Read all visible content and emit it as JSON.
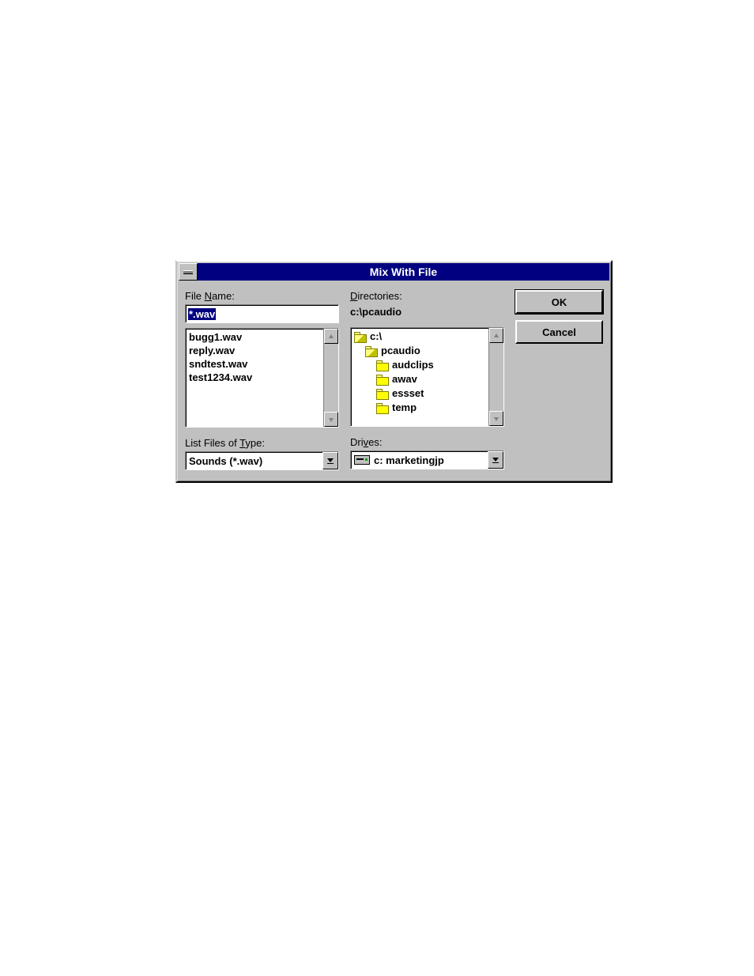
{
  "title": "Mix With File",
  "labels": {
    "file_name_pre": "File ",
    "file_name_ul": "N",
    "file_name_post": "ame:",
    "directories_ul": "D",
    "directories_post": "irectories:",
    "list_type_pre": "List Files of ",
    "list_type_ul": "T",
    "list_type_post": "ype:",
    "drives_pre": "Dri",
    "drives_ul": "v",
    "drives_post": "es:"
  },
  "filename_value": "*.wav",
  "files": [
    "bugg1.wav",
    "reply.wav",
    "sndtest.wav",
    "test1234.wav"
  ],
  "current_path": "c:\\pcaudio",
  "dirs": {
    "root": "c:\\",
    "open": "pcaudio",
    "children": [
      "audclips",
      "awav",
      "essset",
      "temp"
    ]
  },
  "filetype_value": "Sounds (*.wav)",
  "drive_value": "c: marketingjp",
  "buttons": {
    "ok": "OK",
    "cancel": "Cancel"
  }
}
